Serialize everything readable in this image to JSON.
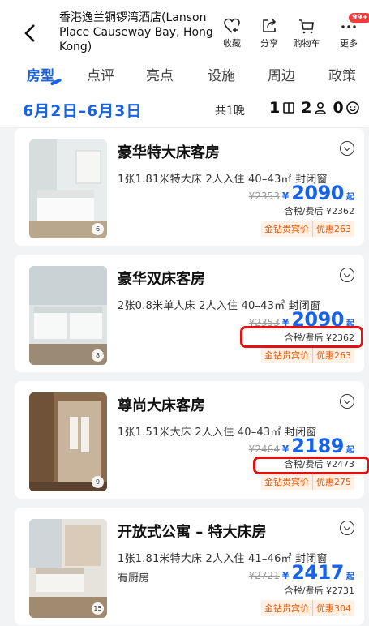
{
  "header": {
    "back_label": "<",
    "hotel_name": "香港逸兰铜锣湾酒店(Lanson Place Causeway Bay, Hong Kong)",
    "actions": [
      {
        "icon": "heart-icon",
        "label": "收藏"
      },
      {
        "icon": "share-icon",
        "label": "分享"
      },
      {
        "icon": "cart-icon",
        "label": "购物车"
      },
      {
        "icon": "more-icon",
        "label": "更多",
        "badge": "99+"
      }
    ]
  },
  "tabs": [
    "房型",
    "点评",
    "亮点",
    "设施",
    "周边",
    "政策"
  ],
  "datebar": {
    "date_range": "6月2日–6月3日",
    "nights": "共1晚",
    "rooms": "1",
    "adults": "2",
    "children": "0"
  },
  "rooms": [
    {
      "name": "豪华特大床客房",
      "spec": "1张1.81米特大床  2人入住  40–43㎡  封闭窗",
      "spec2": "",
      "orig": "¥2353",
      "yen": "¥",
      "price": "2090",
      "qi": "起",
      "tax": "含税/费后 ¥2362",
      "tag1": "金钻贵宾价",
      "tag2": "优惠263",
      "photo_count": "6"
    },
    {
      "name": "豪华双床客房",
      "spec": "2张0.8米单人床  2人入住  40–43㎡  封闭窗",
      "spec2": "",
      "orig": "¥2353",
      "yen": "¥",
      "price": "2090",
      "qi": "起",
      "tax": "含税/费后 ¥2362",
      "tag1": "金钻贵宾价",
      "tag2": "优惠263",
      "photo_count": "8"
    },
    {
      "name": "尊尚大床客房",
      "spec": "1张1.51米大床  2人入住  40–43㎡  封闭窗",
      "spec2": "",
      "orig": "¥2464",
      "yen": "¥",
      "price": "2189",
      "qi": "起",
      "tax": "含税/费后 ¥2473",
      "tag1": "金钻贵宾价",
      "tag2": "优惠275",
      "photo_count": "9"
    },
    {
      "name": "开放式公寓 – 特大床房",
      "spec": "1张1.81米特大床  2人入住  41–46㎡  封闭窗",
      "spec2": "有厨房",
      "orig": "¥2721",
      "yen": "¥",
      "price": "2417",
      "qi": "起",
      "tax": "含税/费后 ¥2731",
      "tag1": "金钻贵宾价",
      "tag2": "优惠304",
      "photo_count": "15"
    }
  ],
  "colors": {
    "accent": "#1763e8",
    "highlight": "#e01313",
    "tag": "#e35a0e"
  }
}
